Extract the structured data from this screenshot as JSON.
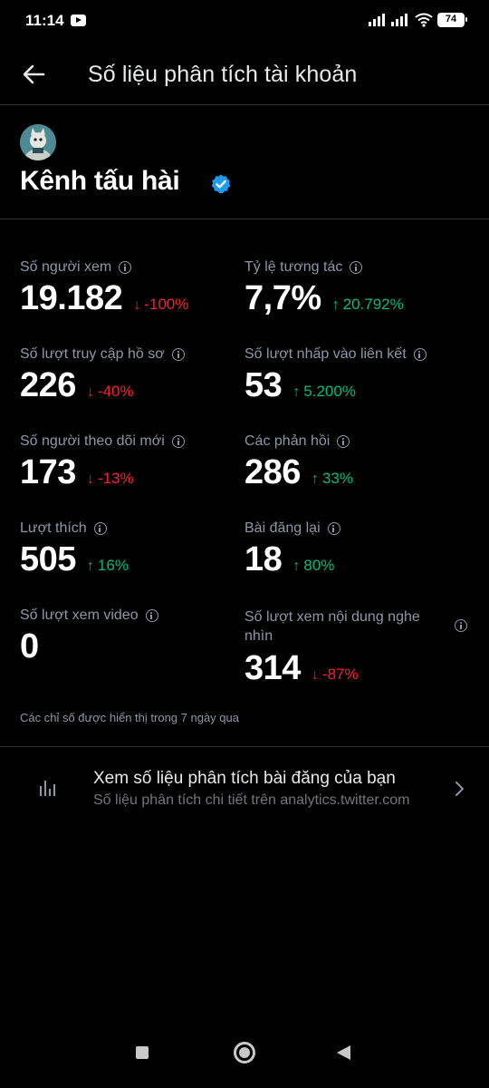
{
  "status_bar": {
    "time": "11:14",
    "battery": "74"
  },
  "header": {
    "title": "Số liệu phân tích tài khoản"
  },
  "profile": {
    "name": "Kênh tấu hài",
    "verified": true
  },
  "metrics": [
    {
      "label": "Số người xem",
      "value": "19.182",
      "change": "-100%",
      "direction": "down"
    },
    {
      "label": "Tỷ lệ tương tác",
      "value": "7,7%",
      "change": "20.792%",
      "direction": "up"
    },
    {
      "label": "Số lượt truy cập hồ sơ",
      "value": "226",
      "change": "-40%",
      "direction": "down"
    },
    {
      "label": "Số lượt nhấp vào liên kết",
      "value": "53",
      "change": "5.200%",
      "direction": "up"
    },
    {
      "label": "Số người theo dõi mới",
      "value": "173",
      "change": "-13%",
      "direction": "down"
    },
    {
      "label": "Các phản hồi",
      "value": "286",
      "change": "33%",
      "direction": "up"
    },
    {
      "label": "Lượt thích",
      "value": "505",
      "change": "16%",
      "direction": "up"
    },
    {
      "label": "Bài đăng lại",
      "value": "18",
      "change": "80%",
      "direction": "up"
    },
    {
      "label": "Số lượt xem video",
      "value": "0",
      "change": "",
      "direction": ""
    },
    {
      "label": "Số lượt xem nội dung nghe nhìn",
      "value": "314",
      "change": "-87%",
      "direction": "down"
    }
  ],
  "footnote": "Các chỉ số được hiển thị trong 7 ngày qua",
  "post_analytics": {
    "title": "Xem số liệu phân tích bài đăng của bạn",
    "subtitle": "Số liệu phân tích chi tiết trên analytics.twitter.com"
  },
  "colors": {
    "up": "#00ba7c",
    "down": "#f4212e",
    "verified": "#1d9bf0"
  }
}
